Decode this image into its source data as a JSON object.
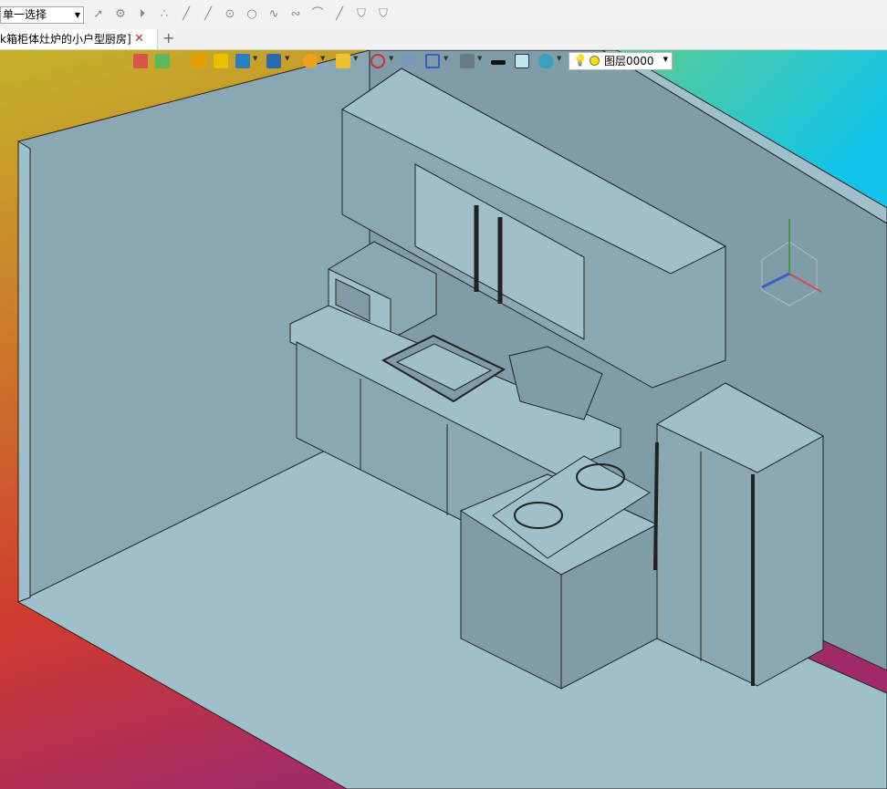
{
  "toolbar": {
    "select_mode": "单一选择",
    "icons": [
      "cursor-icon",
      "pick-gear-icon",
      "play-circle-icon",
      "points-icon",
      "line-icon",
      "line-pick-icon",
      "circle-center-icon",
      "circle-icon",
      "spline-icon",
      "curve-icon",
      "arc-icon",
      "line-dot-icon",
      "hat-icon",
      "hat-alt-icon"
    ]
  },
  "tabs": {
    "doc_title": "k箱柜体灶炉的小户型厨房]",
    "close_glyph": "✕",
    "add_glyph": "+"
  },
  "view_toolbar": {
    "layer_name": "图层0000",
    "layer_bulb_glyph": "💡"
  },
  "scene": {
    "background_gradient": [
      "#d8b01a",
      "#c2412f",
      "#9d2a7a",
      "#12c6e6",
      "#3fd0d6"
    ],
    "model_color": "#9fbfcb",
    "shadow_color": "#7f9ca8",
    "axis_colors": {
      "x": "#d05050",
      "y": "#3fa040",
      "z": "#4060c0"
    }
  }
}
